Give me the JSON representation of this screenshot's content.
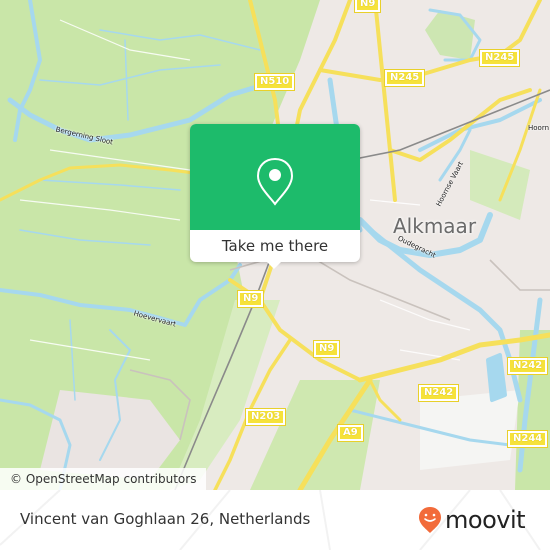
{
  "map": {
    "city_label": "Alkmaar",
    "road_labels": {
      "n9_top": "N9",
      "n510": "N510",
      "n245_left": "N245",
      "n245_right": "N245",
      "n9_mid": "N9",
      "n9_lower": "N9",
      "n242_mid": "N242",
      "n242_right": "N242",
      "n203": "N203",
      "a9": "A9",
      "n244": "N244"
    },
    "water_labels": {
      "bergerning_sloot": "Bergerning Sloot",
      "hoevervaart": "Hoevervaart",
      "hoornse_vaart": "Hoornse Vaart",
      "oudegracht": "Oudegracht",
      "hoorn": "Hoorn"
    },
    "colors": {
      "farmland": "#c9e6a8",
      "urban": "#ede8e4",
      "water": "#a6d8ee",
      "road": "#f6e05b",
      "rail": "#8a8a8a"
    }
  },
  "popup": {
    "button_label": "Take me there",
    "pin_icon": "location-pin-icon",
    "accent": "#1dbb6b"
  },
  "attribution": "© OpenStreetMap contributors",
  "footer": {
    "address": "Vincent van Goghlaan 26, Netherlands",
    "brand": "moovit",
    "brand_color": "#f26b3a"
  }
}
